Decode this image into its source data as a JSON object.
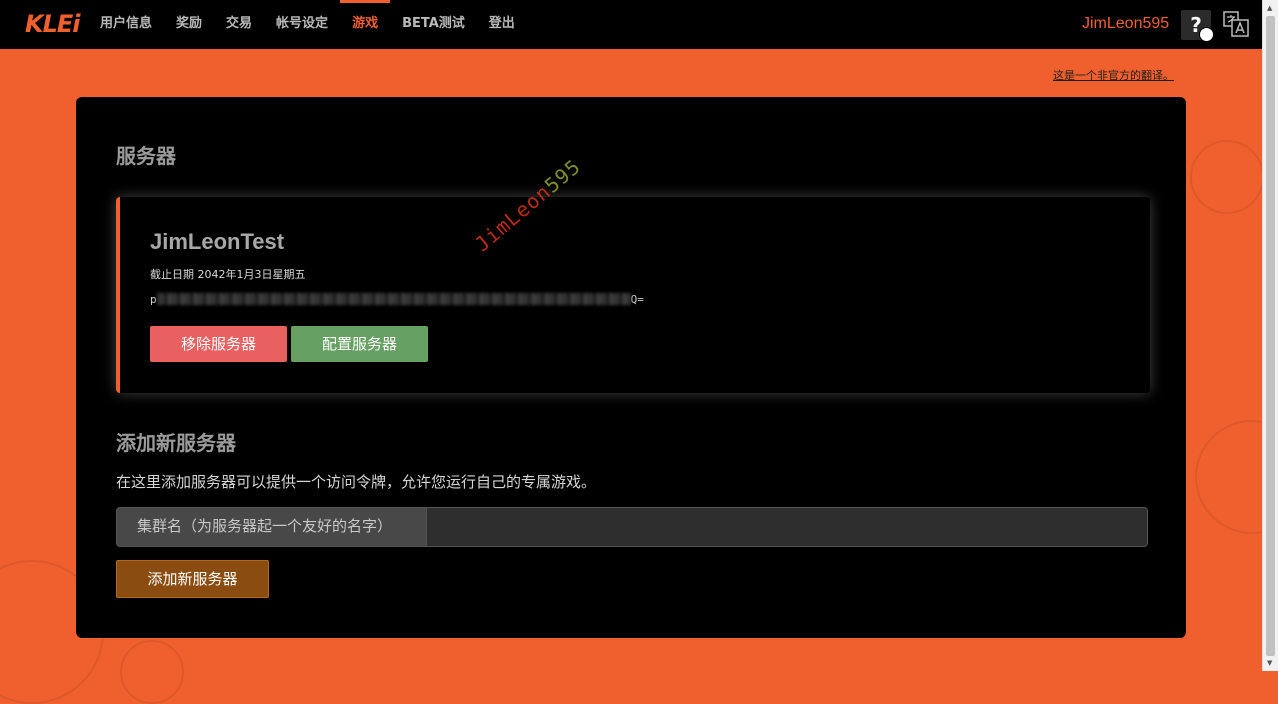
{
  "brand": {
    "logo_text": "KLEi",
    "accent": "#f0602e"
  },
  "nav": {
    "items": [
      {
        "label": "用户信息",
        "active": false
      },
      {
        "label": "奖励",
        "active": false
      },
      {
        "label": "交易",
        "active": false
      },
      {
        "label": "帐号设定",
        "active": false
      },
      {
        "label": "游戏",
        "active": true
      },
      {
        "label": "BETA测试",
        "active": false
      },
      {
        "label": "登出",
        "active": false
      }
    ],
    "username": "JimLeon595",
    "help_icon": "help-icon",
    "help_text": "?",
    "translate_icon": "translate-icon"
  },
  "translation_note": "这是一个非官方的翻译。",
  "servers_section": {
    "title": "服务器",
    "server": {
      "name": "JimLeonTest",
      "expiry": "截止日期 2042年1月3日星期五",
      "token_prefix": "p",
      "token_suffix": "Q=",
      "remove_label": "移除服务器",
      "configure_label": "配置服务器"
    }
  },
  "add_section": {
    "title": "添加新服务器",
    "description": "在这里添加服务器可以提供一个访问令牌，允许您运行自己的专属游戏。",
    "field_label": "集群名（为服务器起一个友好的名字）",
    "field_value": "",
    "add_label": "添加新服务器"
  },
  "watermark": {
    "text": "JimLeon",
    "tail": "595"
  },
  "colors": {
    "remove": "#e86060",
    "configure": "#66a063",
    "add": "#8a4c10",
    "panel": "#000000"
  }
}
